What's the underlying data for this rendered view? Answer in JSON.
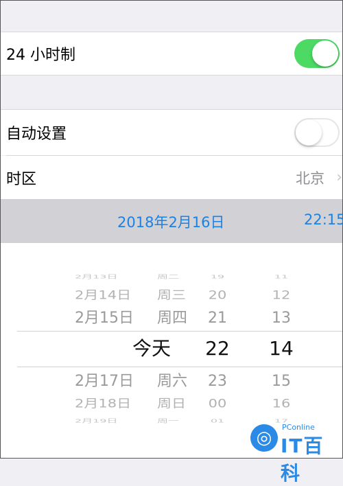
{
  "settings": {
    "hour24": {
      "label": "24 小时制",
      "on": true
    },
    "auto_set": {
      "label": "自动设置",
      "on": false
    },
    "timezone": {
      "label": "时区",
      "value": "北京"
    }
  },
  "selected": {
    "date": "2018年2月16日",
    "time": "22:15"
  },
  "picker": {
    "rows": [
      {
        "date": "2月13日",
        "day": "周二",
        "hour": "19",
        "minute": "11"
      },
      {
        "date": "2月14日",
        "day": "周三",
        "hour": "20",
        "minute": "12"
      },
      {
        "date": "2月15日",
        "day": "周四",
        "hour": "21",
        "minute": "13"
      },
      {
        "date": "今天",
        "day": "",
        "hour": "22",
        "minute": "14"
      },
      {
        "date": "2月17日",
        "day": "周六",
        "hour": "23",
        "minute": "15"
      },
      {
        "date": "2月18日",
        "day": "周日",
        "hour": "00",
        "minute": "16"
      },
      {
        "date": "2月19日",
        "day": "周一",
        "hour": "01",
        "minute": "17"
      }
    ]
  },
  "watermark": {
    "small": "PConline",
    "big": "IT百科",
    "logo": "◎"
  },
  "colors": {
    "switch_on": "#4cd964",
    "accent": "#1a82e6",
    "selected_bar": "#d1d1d6"
  }
}
